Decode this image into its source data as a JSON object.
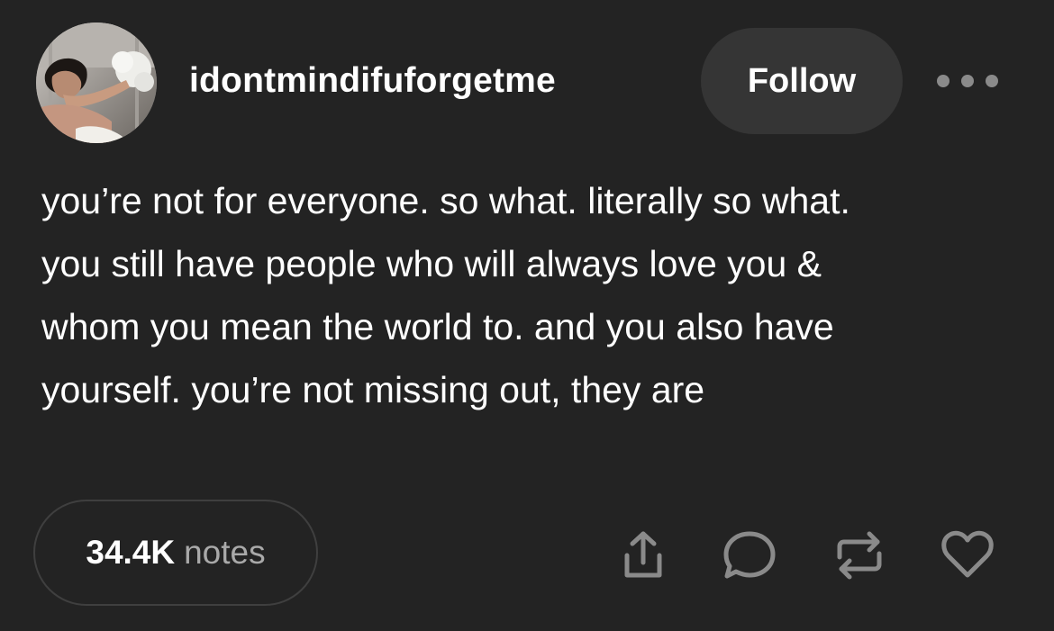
{
  "post": {
    "author": "idontmindifuforgetme",
    "follow_label": "Follow",
    "body_lines": [
      "you’re not for everyone. so what. literally so what.",
      "you still have people who will always love you &",
      "whom you mean the world to. and you also have",
      "yourself. you’re not missing out, they are"
    ],
    "notes": {
      "count": "34.4K",
      "label": "notes"
    }
  },
  "icons": {
    "more": "more-dots-icon",
    "share": "share-icon",
    "reply": "comment-icon",
    "reblog": "reblog-icon",
    "like": "heart-icon"
  },
  "colors": {
    "background": "#232323",
    "button": "#353535",
    "icon": "#8a8a8a",
    "text": "#ffffff",
    "muted": "#a9a9a9"
  }
}
